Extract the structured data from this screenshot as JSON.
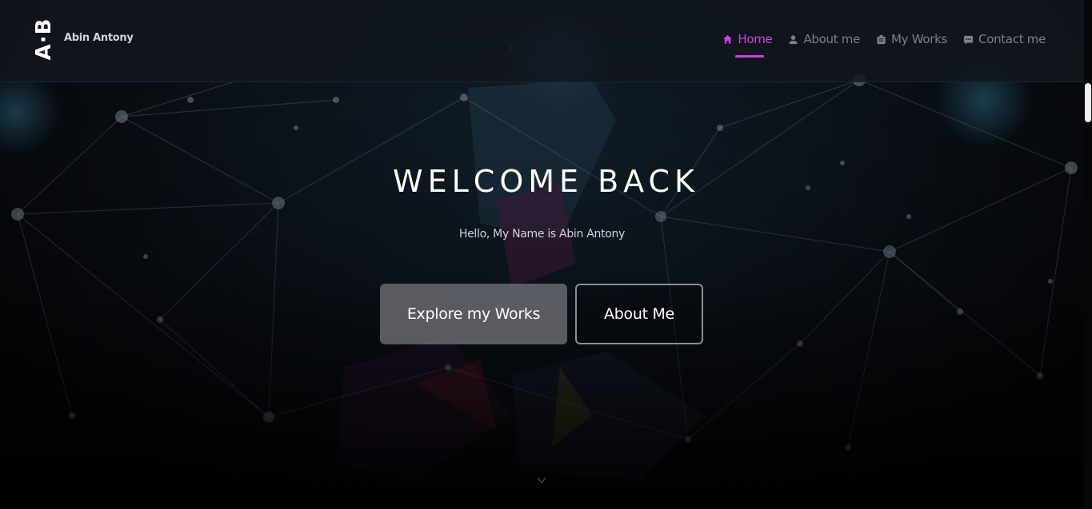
{
  "brand": {
    "logo_text": "A·B",
    "name": "Abin Antony"
  },
  "nav": {
    "items": [
      {
        "label": "Home",
        "icon": "home-icon",
        "active": true
      },
      {
        "label": "About me",
        "icon": "user-icon",
        "active": false
      },
      {
        "label": "My Works",
        "icon": "briefcase-icon",
        "active": false
      },
      {
        "label": "Contact me",
        "icon": "chat-icon",
        "active": false
      }
    ]
  },
  "hero": {
    "title": "WELCOME BACK",
    "subtitle": "Hello, My Name is Abin Antony",
    "primary_button": "Explore my Works",
    "secondary_button": "About Me",
    "scroll_icon": "chevron-down-icon"
  },
  "colors": {
    "accent": "#d13fe0",
    "header_bg": "#12161e",
    "page_bg": "#050608"
  }
}
